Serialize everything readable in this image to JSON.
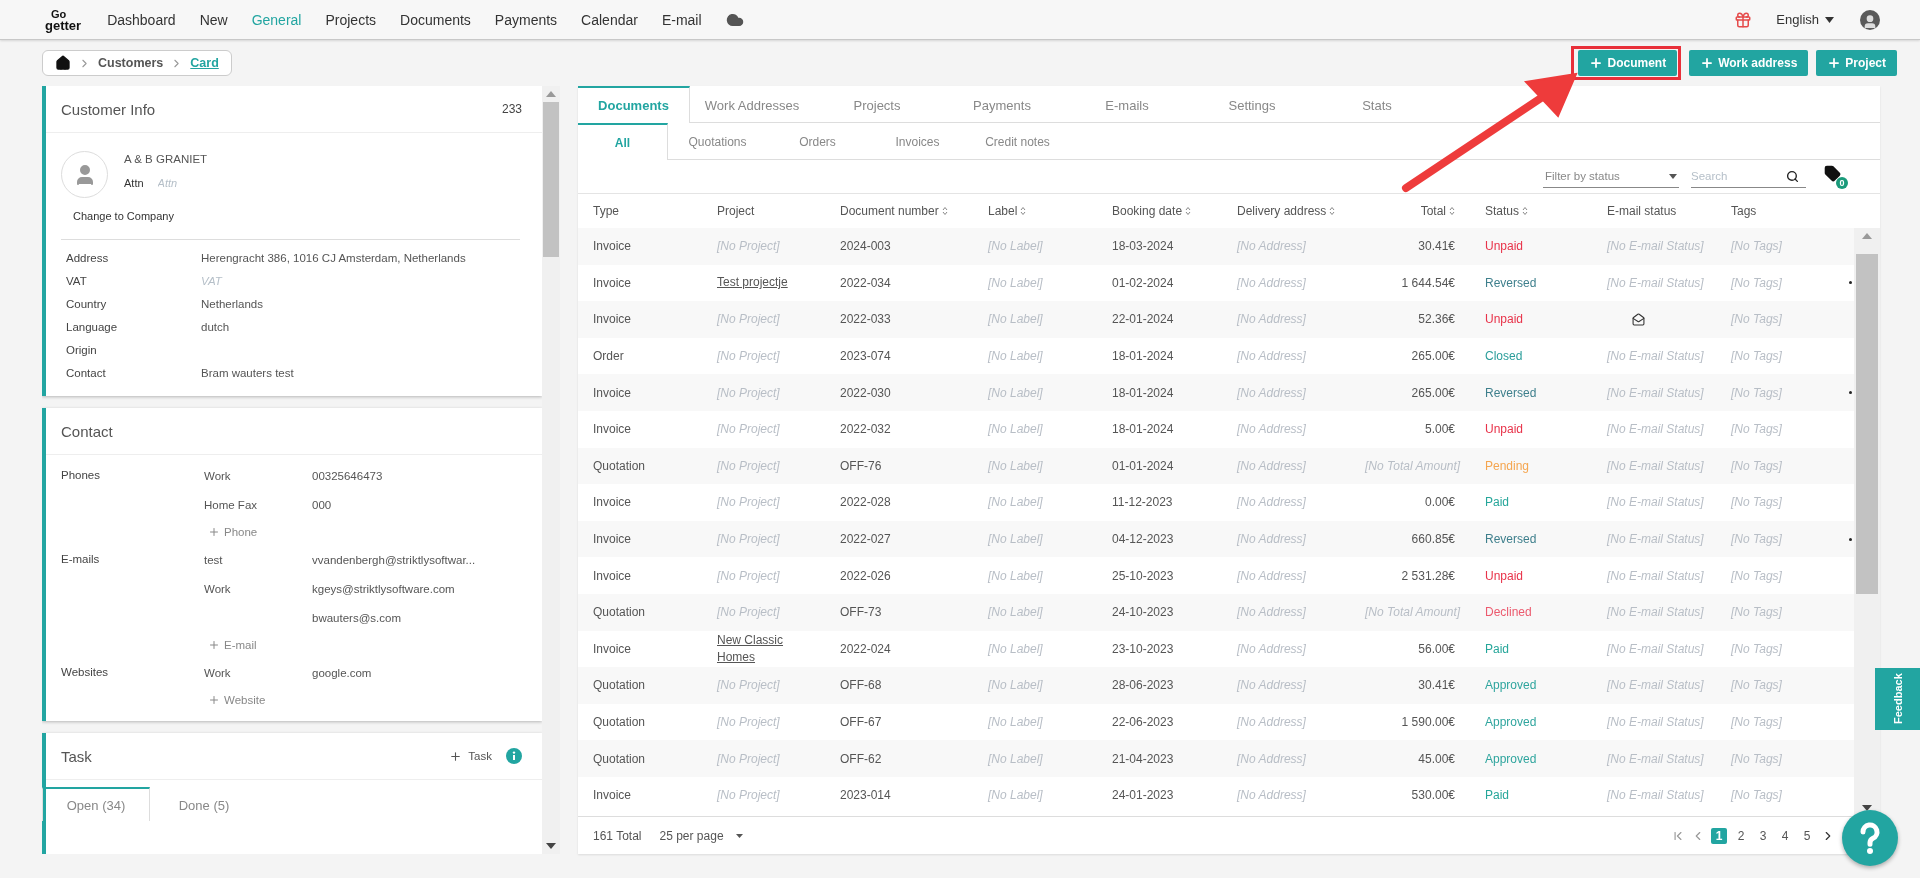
{
  "nav": {
    "logo": [
      "Go",
      "getter"
    ],
    "items": [
      {
        "label": "Dashboard",
        "selected": false
      },
      {
        "label": "New",
        "selected": false
      },
      {
        "label": "General",
        "selected": true
      },
      {
        "label": "Projects",
        "selected": false
      },
      {
        "label": "Documents",
        "selected": false
      },
      {
        "label": "Payments",
        "selected": false
      },
      {
        "label": "Calendar",
        "selected": false
      },
      {
        "label": "E-mail",
        "selected": false
      }
    ],
    "language": "English"
  },
  "breadcrumb": [
    {
      "label": "Customers",
      "current": false
    },
    {
      "label": "Card",
      "current": true
    }
  ],
  "actions": [
    {
      "label": "Document",
      "highlighted": true
    },
    {
      "label": "Work address",
      "highlighted": false
    },
    {
      "label": "Project",
      "highlighted": false
    }
  ],
  "customer_info": {
    "title": "Customer Info",
    "count": "233",
    "name": "A & B GRANIET",
    "attn_label": "Attn",
    "attn_placeholder": "Attn",
    "change_link": "Change to Company",
    "fields": [
      {
        "label": "Address",
        "value": "Herengracht 386, 1016 CJ Amsterdam, Netherlands"
      },
      {
        "label": "VAT",
        "placeholder": "VAT"
      },
      {
        "label": "Country",
        "value": "Netherlands"
      },
      {
        "label": "Language",
        "value": "dutch"
      },
      {
        "label": "Origin"
      },
      {
        "label": "Contact",
        "value": "Bram wauters test"
      }
    ]
  },
  "contact": {
    "title": "Contact",
    "groups": [
      {
        "label": "Phones",
        "entries": [
          {
            "type": "Work",
            "value": "00325646473"
          },
          {
            "type": "Home Fax",
            "value": "000"
          }
        ],
        "add": "Phone"
      },
      {
        "label": "E-mails",
        "entries": [
          {
            "type": "test",
            "value": "vvandenbergh@striktlysoftwar..."
          },
          {
            "type": "Work",
            "value": "kgeys@striktlysoftware.com"
          },
          {
            "value": "bwauters@s.com"
          }
        ],
        "add": "E-mail"
      },
      {
        "label": "Websites",
        "entries": [
          {
            "type": "Work",
            "value": "google.com"
          }
        ],
        "add": "Website"
      }
    ]
  },
  "task": {
    "title": "Task",
    "add": "Task",
    "tabs": [
      {
        "label": "Open (34)",
        "selected": true
      },
      {
        "label": "Done (5)",
        "selected": false
      }
    ]
  },
  "documents": {
    "tabs": [
      {
        "label": "Documents",
        "selected": true
      },
      {
        "label": "Work Addresses",
        "selected": false
      },
      {
        "label": "Projects",
        "selected": false
      },
      {
        "label": "Payments",
        "selected": false
      },
      {
        "label": "E-mails",
        "selected": false
      },
      {
        "label": "Settings",
        "selected": false
      },
      {
        "label": "Stats",
        "selected": false
      }
    ],
    "subtabs": [
      {
        "label": "All",
        "selected": true
      },
      {
        "label": "Quotations",
        "selected": false
      },
      {
        "label": "Orders",
        "selected": false
      },
      {
        "label": "Invoices",
        "selected": false
      },
      {
        "label": "Credit notes",
        "selected": false
      }
    ],
    "filter": {
      "placeholder": "Filter by status"
    },
    "search": {
      "placeholder": "Search"
    },
    "tag_count": "0",
    "columns": [
      {
        "label": "Type",
        "sortable": false
      },
      {
        "label": "Project",
        "sortable": false
      },
      {
        "label": "Document number",
        "sortable": true
      },
      {
        "label": "Label",
        "sortable": true
      },
      {
        "label": "Booking date",
        "sortable": true
      },
      {
        "label": "Delivery address",
        "sortable": true
      },
      {
        "label": "Total",
        "sortable": true
      },
      {
        "label": "Status",
        "sortable": true
      },
      {
        "label": "E-mail status",
        "sortable": false
      },
      {
        "label": "Tags",
        "sortable": false
      }
    ],
    "rows": [
      {
        "dot": false,
        "cells": [
          {
            "text": "Invoice"
          },
          {
            "text": "[No Project]",
            "kind": "none"
          },
          {
            "text": "2024-003"
          },
          {
            "text": "[No Label]",
            "kind": "none"
          },
          {
            "text": "18-03-2024"
          },
          {
            "text": "[No Address]",
            "kind": "none"
          },
          {
            "text": "30.41€"
          },
          {
            "text": "Unpaid",
            "kind": "status",
            "color": "#e8334a"
          },
          {
            "text": "[No E-mail Status]",
            "kind": "none"
          },
          {
            "text": "[No Tags]",
            "kind": "none"
          }
        ]
      },
      {
        "dot": true,
        "cells": [
          {
            "text": "Invoice"
          },
          {
            "text": "Test projectje",
            "kind": "link"
          },
          {
            "text": "2022-034"
          },
          {
            "text": "[No Label]",
            "kind": "none"
          },
          {
            "text": "01-02-2024"
          },
          {
            "text": "[No Address]",
            "kind": "none"
          },
          {
            "text": "1 644.54€"
          },
          {
            "text": "Reversed",
            "kind": "status",
            "color": "#3e7f8c"
          },
          {
            "text": "[No E-mail Status]",
            "kind": "none"
          },
          {
            "text": "[No Tags]",
            "kind": "none"
          }
        ]
      },
      {
        "dot": false,
        "cells": [
          {
            "text": "Invoice"
          },
          {
            "text": "[No Project]",
            "kind": "none"
          },
          {
            "text": "2022-033"
          },
          {
            "text": "[No Label]",
            "kind": "none"
          },
          {
            "text": "22-01-2024"
          },
          {
            "text": "[No Address]",
            "kind": "none"
          },
          {
            "text": "52.36€"
          },
          {
            "text": "Unpaid",
            "kind": "status",
            "color": "#e8334a"
          },
          {
            "kind": "icon"
          },
          {
            "text": "[No Tags]",
            "kind": "none"
          }
        ]
      },
      {
        "dot": false,
        "cells": [
          {
            "text": "Order"
          },
          {
            "text": "[No Project]",
            "kind": "none"
          },
          {
            "text": "2023-074"
          },
          {
            "text": "[No Label]",
            "kind": "none"
          },
          {
            "text": "18-01-2024"
          },
          {
            "text": "[No Address]",
            "kind": "none"
          },
          {
            "text": "265.00€"
          },
          {
            "text": "Closed",
            "kind": "status",
            "color": "#2a9d9a"
          },
          {
            "text": "[No E-mail Status]",
            "kind": "none"
          },
          {
            "text": "[No Tags]",
            "kind": "none"
          }
        ]
      },
      {
        "dot": true,
        "cells": [
          {
            "text": "Invoice"
          },
          {
            "text": "[No Project]",
            "kind": "none"
          },
          {
            "text": "2022-030"
          },
          {
            "text": "[No Label]",
            "kind": "none"
          },
          {
            "text": "18-01-2024"
          },
          {
            "text": "[No Address]",
            "kind": "none"
          },
          {
            "text": "265.00€"
          },
          {
            "text": "Reversed",
            "kind": "status",
            "color": "#3e7f8c"
          },
          {
            "text": "[No E-mail Status]",
            "kind": "none"
          },
          {
            "text": "[No Tags]",
            "kind": "none"
          }
        ]
      },
      {
        "dot": false,
        "cells": [
          {
            "text": "Invoice"
          },
          {
            "text": "[No Project]",
            "kind": "none"
          },
          {
            "text": "2022-032"
          },
          {
            "text": "[No Label]",
            "kind": "none"
          },
          {
            "text": "18-01-2024"
          },
          {
            "text": "[No Address]",
            "kind": "none"
          },
          {
            "text": "5.00€"
          },
          {
            "text": "Unpaid",
            "kind": "status",
            "color": "#e8334a"
          },
          {
            "text": "[No E-mail Status]",
            "kind": "none"
          },
          {
            "text": "[No Tags]",
            "kind": "none"
          }
        ]
      },
      {
        "dot": false,
        "cells": [
          {
            "text": "Quotation"
          },
          {
            "text": "[No Project]",
            "kind": "none"
          },
          {
            "text": "OFF-76"
          },
          {
            "text": "[No Label]",
            "kind": "none"
          },
          {
            "text": "01-01-2024"
          },
          {
            "text": "[No Address]",
            "kind": "none"
          },
          {
            "text": "[No Total Amount]",
            "kind": "none"
          },
          {
            "text": "Pending",
            "kind": "status",
            "color": "#f5a650"
          },
          {
            "text": "[No E-mail Status]",
            "kind": "none"
          },
          {
            "text": "[No Tags]",
            "kind": "none"
          }
        ]
      },
      {
        "dot": false,
        "cells": [
          {
            "text": "Invoice"
          },
          {
            "text": "[No Project]",
            "kind": "none"
          },
          {
            "text": "2022-028"
          },
          {
            "text": "[No Label]",
            "kind": "none"
          },
          {
            "text": "11-12-2023"
          },
          {
            "text": "[No Address]",
            "kind": "none"
          },
          {
            "text": "0.00€"
          },
          {
            "text": "Paid",
            "kind": "status",
            "color": "#26a69a"
          },
          {
            "text": "[No E-mail Status]",
            "kind": "none"
          },
          {
            "text": "[No Tags]",
            "kind": "none"
          }
        ]
      },
      {
        "dot": true,
        "cells": [
          {
            "text": "Invoice"
          },
          {
            "text": "[No Project]",
            "kind": "none"
          },
          {
            "text": "2022-027"
          },
          {
            "text": "[No Label]",
            "kind": "none"
          },
          {
            "text": "04-12-2023"
          },
          {
            "text": "[No Address]",
            "kind": "none"
          },
          {
            "text": "660.85€"
          },
          {
            "text": "Reversed",
            "kind": "status",
            "color": "#3e7f8c"
          },
          {
            "text": "[No E-mail Status]",
            "kind": "none"
          },
          {
            "text": "[No Tags]",
            "kind": "none"
          }
        ]
      },
      {
        "dot": false,
        "cells": [
          {
            "text": "Invoice"
          },
          {
            "text": "[No Project]",
            "kind": "none"
          },
          {
            "text": "2022-026"
          },
          {
            "text": "[No Label]",
            "kind": "none"
          },
          {
            "text": "25-10-2023"
          },
          {
            "text": "[No Address]",
            "kind": "none"
          },
          {
            "text": "2 531.28€"
          },
          {
            "text": "Unpaid",
            "kind": "status",
            "color": "#e8334a"
          },
          {
            "text": "[No E-mail Status]",
            "kind": "none"
          },
          {
            "text": "[No Tags]",
            "kind": "none"
          }
        ]
      },
      {
        "dot": false,
        "cells": [
          {
            "text": "Quotation"
          },
          {
            "text": "[No Project]",
            "kind": "none"
          },
          {
            "text": "OFF-73"
          },
          {
            "text": "[No Label]",
            "kind": "none"
          },
          {
            "text": "24-10-2023"
          },
          {
            "text": "[No Address]",
            "kind": "none"
          },
          {
            "text": "[No Total Amount]",
            "kind": "none"
          },
          {
            "text": "Declined",
            "kind": "status",
            "color": "#ec5a6e"
          },
          {
            "text": "[No E-mail Status]",
            "kind": "none"
          },
          {
            "text": "[No Tags]",
            "kind": "none"
          }
        ]
      },
      {
        "dot": false,
        "cells": [
          {
            "text": "Invoice"
          },
          {
            "text": "New Classic Homes",
            "kind": "link"
          },
          {
            "text": "2022-024"
          },
          {
            "text": "[No Label]",
            "kind": "none"
          },
          {
            "text": "23-10-2023"
          },
          {
            "text": "[No Address]",
            "kind": "none"
          },
          {
            "text": "56.00€"
          },
          {
            "text": "Paid",
            "kind": "status",
            "color": "#26a69a"
          },
          {
            "text": "[No E-mail Status]",
            "kind": "none"
          },
          {
            "text": "[No Tags]",
            "kind": "none"
          }
        ]
      },
      {
        "dot": false,
        "cells": [
          {
            "text": "Quotation"
          },
          {
            "text": "[No Project]",
            "kind": "none"
          },
          {
            "text": "OFF-68"
          },
          {
            "text": "[No Label]",
            "kind": "none"
          },
          {
            "text": "28-06-2023"
          },
          {
            "text": "[No Address]",
            "kind": "none"
          },
          {
            "text": "30.41€"
          },
          {
            "text": "Approved",
            "kind": "status",
            "color": "#2fa59e"
          },
          {
            "text": "[No E-mail Status]",
            "kind": "none"
          },
          {
            "text": "[No Tags]",
            "kind": "none"
          }
        ]
      },
      {
        "dot": false,
        "cells": [
          {
            "text": "Quotation"
          },
          {
            "text": "[No Project]",
            "kind": "none"
          },
          {
            "text": "OFF-67"
          },
          {
            "text": "[No Label]",
            "kind": "none"
          },
          {
            "text": "22-06-2023"
          },
          {
            "text": "[No Address]",
            "kind": "none"
          },
          {
            "text": "1 590.00€"
          },
          {
            "text": "Approved",
            "kind": "status",
            "color": "#2fa59e"
          },
          {
            "text": "[No E-mail Status]",
            "kind": "none"
          },
          {
            "text": "[No Tags]",
            "kind": "none"
          }
        ]
      },
      {
        "dot": false,
        "cells": [
          {
            "text": "Quotation"
          },
          {
            "text": "[No Project]",
            "kind": "none"
          },
          {
            "text": "OFF-62"
          },
          {
            "text": "[No Label]",
            "kind": "none"
          },
          {
            "text": "21-04-2023"
          },
          {
            "text": "[No Address]",
            "kind": "none"
          },
          {
            "text": "45.00€"
          },
          {
            "text": "Approved",
            "kind": "status",
            "color": "#2fa59e"
          },
          {
            "text": "[No E-mail Status]",
            "kind": "none"
          },
          {
            "text": "[No Tags]",
            "kind": "none"
          }
        ]
      },
      {
        "dot": false,
        "cells": [
          {
            "text": "Invoice"
          },
          {
            "text": "[No Project]",
            "kind": "none"
          },
          {
            "text": "2023-014"
          },
          {
            "text": "[No Label]",
            "kind": "none"
          },
          {
            "text": "24-01-2023"
          },
          {
            "text": "[No Address]",
            "kind": "none"
          },
          {
            "text": "530.00€"
          },
          {
            "text": "Paid",
            "kind": "status",
            "color": "#26a69a"
          },
          {
            "text": "[No E-mail Status]",
            "kind": "none"
          },
          {
            "text": "[No Tags]",
            "kind": "none"
          }
        ]
      }
    ],
    "total": "161 Total",
    "per_page": "25 per page",
    "pages": [
      {
        "label": "1",
        "selected": true
      },
      {
        "label": "2",
        "selected": false
      },
      {
        "label": "3",
        "selected": false
      },
      {
        "label": "4",
        "selected": false
      },
      {
        "label": "5",
        "selected": false
      }
    ]
  },
  "feedback": "Feedback"
}
